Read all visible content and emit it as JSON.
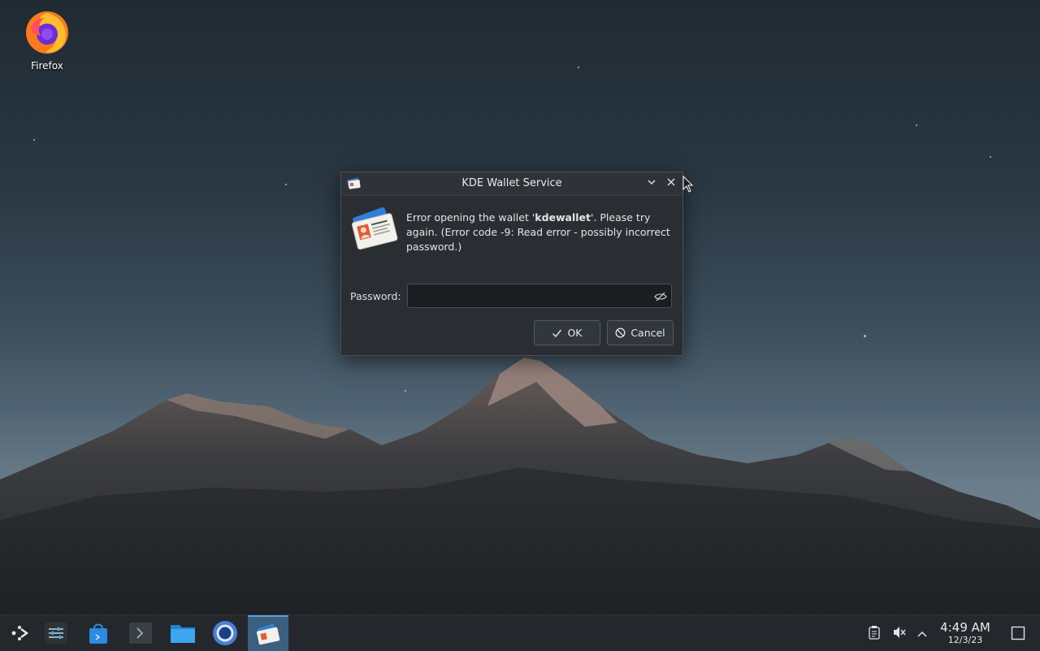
{
  "desktop": {
    "icons": [
      {
        "label": "Firefox",
        "icon": "firefox-icon"
      }
    ]
  },
  "dialog": {
    "title": "KDE Wallet Service",
    "message_pre": "Error opening the wallet '",
    "message_bold": "kdewallet",
    "message_post": "'. Please try again. (Error code -9: Read error - possibly incorrect password.)",
    "password_label": "Password:",
    "password_value": "",
    "ok_label": "OK",
    "cancel_label": "Cancel"
  },
  "taskbar": {
    "apps": [
      {
        "name": "application-launcher",
        "icon": "kde-launcher-icon"
      },
      {
        "name": "system-settings",
        "icon": "sliders-icon"
      },
      {
        "name": "discover",
        "icon": "shopping-bag-icon"
      },
      {
        "name": "konsole",
        "icon": "terminal-icon"
      },
      {
        "name": "dolphin",
        "icon": "folder-icon"
      },
      {
        "name": "steam",
        "icon": "circle-app-icon"
      },
      {
        "name": "kwallet",
        "icon": "wallet-card-icon",
        "active": true
      }
    ],
    "tray": {
      "clipboard": "clipboard-icon",
      "volume": "volume-muted-icon",
      "expand": "chevron-up-icon"
    },
    "clock": {
      "time": "4:49 AM",
      "date": "12/3/23"
    }
  },
  "colors": {
    "panel": "#24282c",
    "dialog_bg": "#2a2e32",
    "accent": "#3b5f7f"
  }
}
